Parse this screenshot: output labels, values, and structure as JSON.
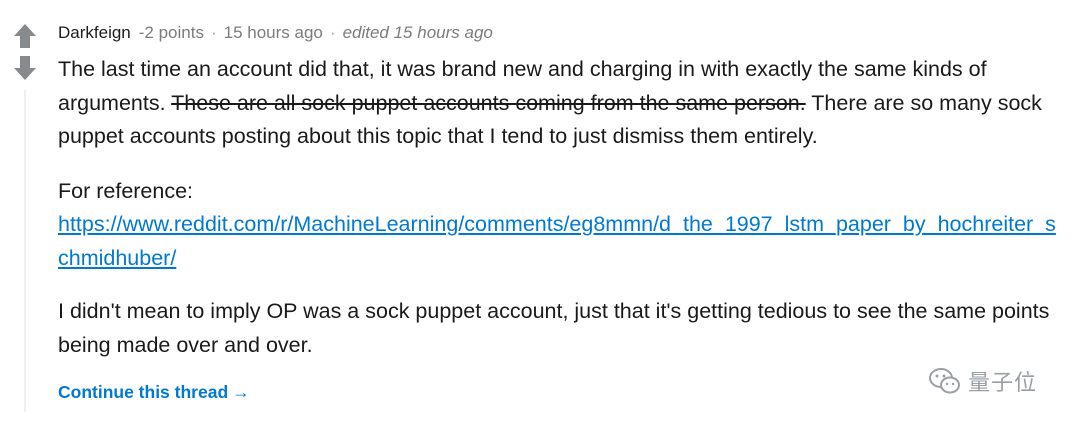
{
  "comment": {
    "author": "Darkfeign",
    "points": "-2 points",
    "time": "15 hours ago",
    "edited": "edited 15 hours ago",
    "paragraphs": {
      "p1_text_a": "The last time an account did that, it was brand new and charging in with exactly the same kinds of arguments. ",
      "p1_struck": "These are all sock puppet accounts coming from the same person.",
      "p1_text_b": " There are so many sock puppet accounts posting about this topic that I tend to just dismiss them entirely.",
      "p2_label": "For reference:",
      "p2_link": "https://www.reddit.com/r/MachineLearning/comments/eg8mmn/d_the_1997_lstm_paper_by_hochreiter_schmidhuber/",
      "p3_text": "I didn't mean to imply OP was a sock puppet account, just that it's getting tedious to see the same points being made over and over."
    },
    "continue_label": "Continue this thread",
    "continue_arrow": "→"
  },
  "icons": {
    "upvote": "upvote-arrow-icon",
    "downvote": "downvote-arrow-icon",
    "watermark_logo": "wechat-logo-icon"
  },
  "watermark": {
    "text": "量子位"
  },
  "colors": {
    "link": "#0079d3",
    "meta": "#7c7c7c",
    "vote_icon": "#878a8c"
  }
}
